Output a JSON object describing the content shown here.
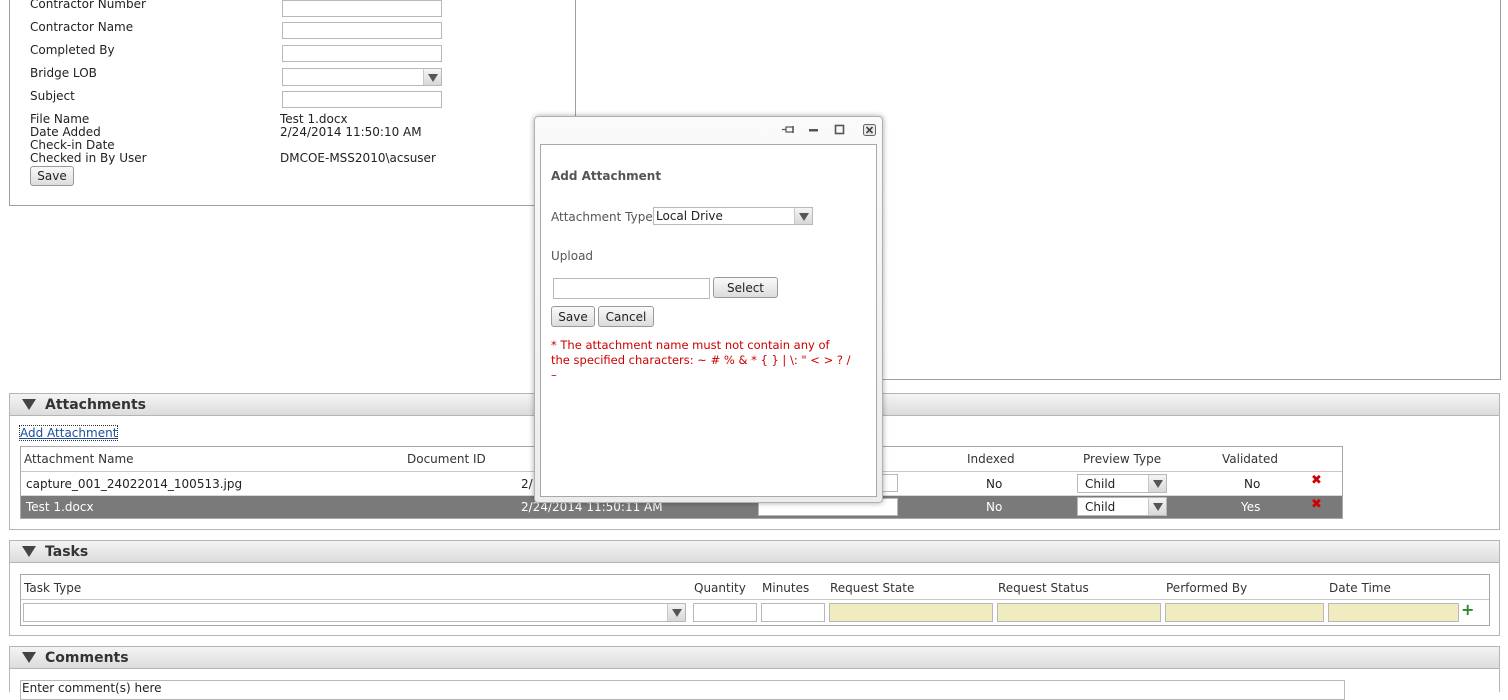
{
  "form": {
    "fields": [
      {
        "label": "Contractor Number",
        "value": ""
      },
      {
        "label": "Contractor Name",
        "value": ""
      },
      {
        "label": "Completed By",
        "value": ""
      },
      {
        "label": "Bridge LOB",
        "value": ""
      },
      {
        "label": "Subject",
        "value": ""
      }
    ],
    "info": [
      {
        "label": "File Name",
        "value": "Test 1.docx"
      },
      {
        "label": "Date Added",
        "value": "2/24/2014 11:50:10 AM"
      },
      {
        "label": "Check-in Date",
        "value": ""
      },
      {
        "label": "Checked in By User",
        "value": "DMCOE-MSS2010\\acsuser"
      }
    ],
    "save_label": "Save"
  },
  "attachments": {
    "title": "Attachments",
    "add_link": "Add Attachment",
    "columns": {
      "name": "Attachment Name",
      "doc_id": "Document ID",
      "indexed": "Indexed",
      "preview": "Preview Type",
      "validated": "Validated"
    },
    "rows": [
      {
        "name": "capture_001_24022014_100513.jpg",
        "date": "2/",
        "indexed": "No",
        "preview": "Child",
        "validated": "No"
      },
      {
        "name": "Test 1.docx",
        "date": "2/24/2014 11:50:11 AM",
        "indexed": "No",
        "preview": "Child",
        "validated": "Yes"
      }
    ]
  },
  "tasks": {
    "title": "Tasks",
    "columns": {
      "task_type": "Task Type",
      "quantity": "Quantity",
      "minutes": "Minutes",
      "request_state": "Request State",
      "request_status": "Request Status",
      "performed_by": "Performed By",
      "date_time": "Date Time"
    }
  },
  "comments": {
    "title": "Comments",
    "placeholder": "Enter comment(s) here"
  },
  "dialog": {
    "heading": "Add Attachment",
    "type_label": "Attachment Type",
    "type_value": "Local Drive",
    "upload_label": "Upload",
    "select_label": "Select",
    "save_label": "Save",
    "cancel_label": "Cancel",
    "warning": "* The attachment name must not contain any of the specified characters: ~ # % & * { } | \\: \" < > ? / –"
  },
  "colors": {
    "selected_row": "#7a7a7a",
    "readonly_field": "#f0ecbf",
    "warning": "#cc0000",
    "add_icon": "#2a8a2a"
  }
}
